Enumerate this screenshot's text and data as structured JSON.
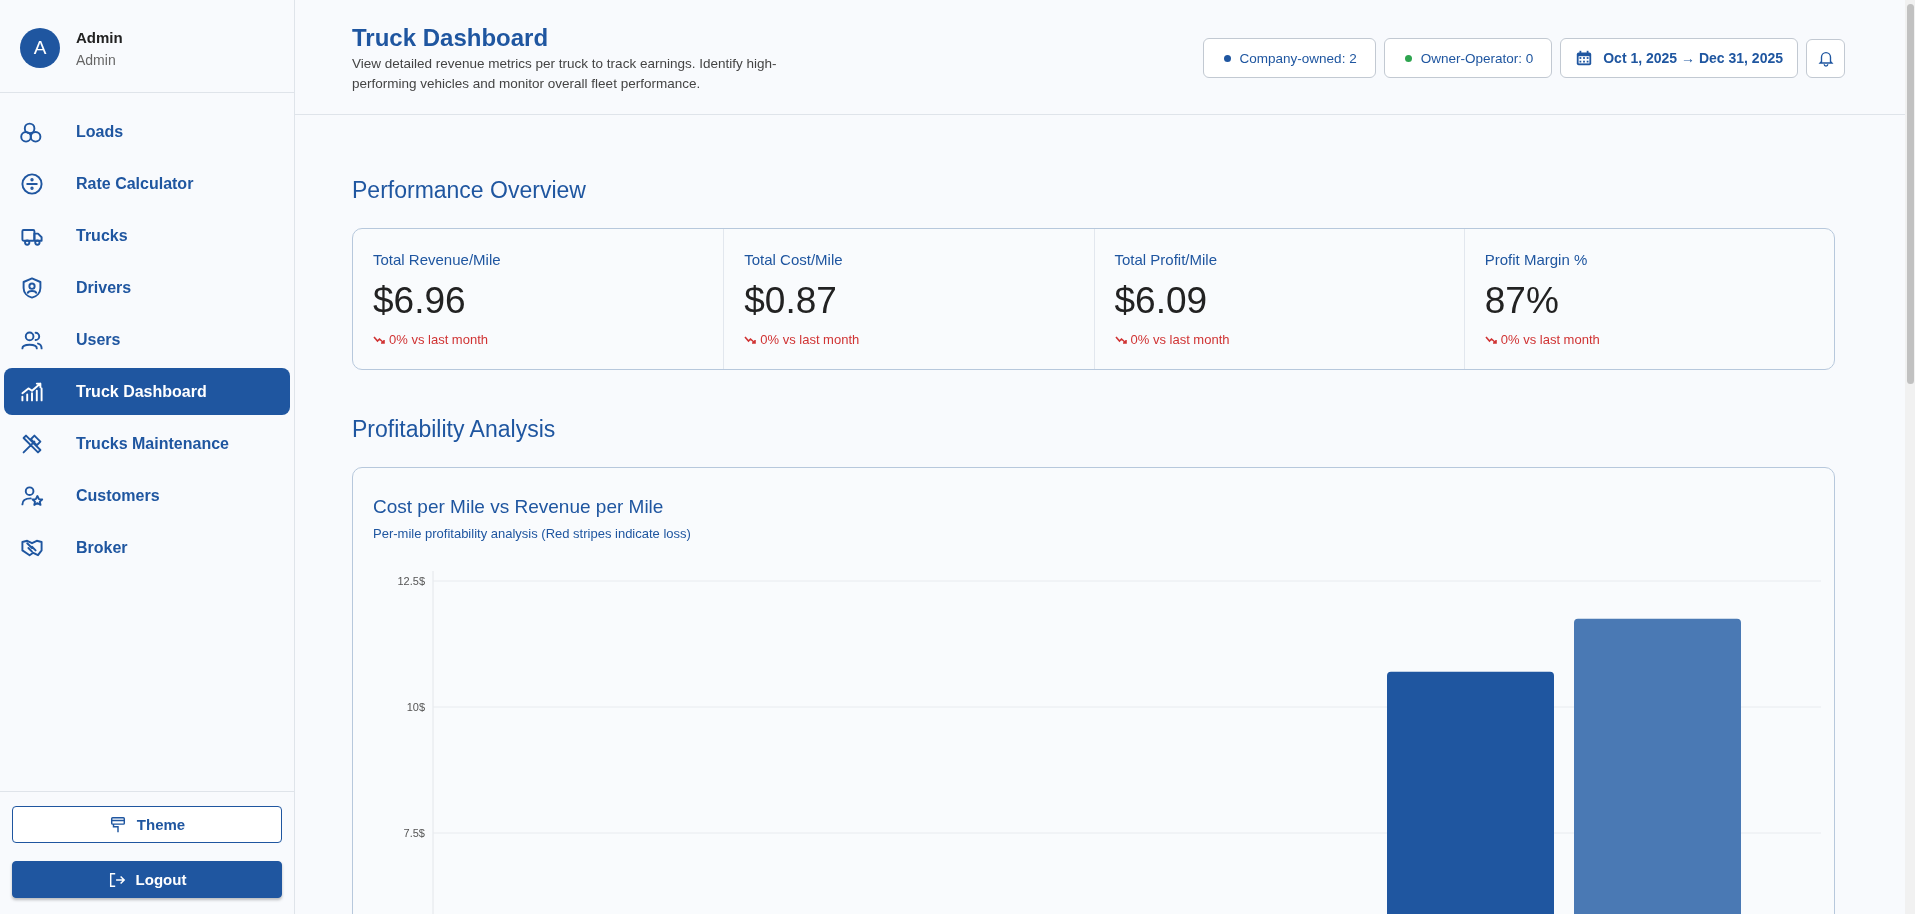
{
  "user": {
    "initial": "A",
    "name": "Admin",
    "role": "Admin"
  },
  "nav": [
    {
      "label": "Loads",
      "selected": false
    },
    {
      "label": "Rate Calculator",
      "selected": false
    },
    {
      "label": "Trucks",
      "selected": false
    },
    {
      "label": "Drivers",
      "selected": false
    },
    {
      "label": "Users",
      "selected": false
    },
    {
      "label": "Truck Dashboard",
      "selected": true
    },
    {
      "label": "Trucks Maintenance",
      "selected": false
    },
    {
      "label": "Customers",
      "selected": false
    },
    {
      "label": "Broker",
      "selected": false
    }
  ],
  "sidebar_buttons": [
    {
      "label": "Theme",
      "kind": "outline"
    },
    {
      "label": "Logout",
      "kind": "filled"
    }
  ],
  "header": {
    "title": "Truck Dashboard",
    "description": "View detailed revenue metrics per truck to track earnings. Identify high-performing vehicles and monitor overall fleet performance.",
    "badges": [
      {
        "label": "Company-owned: 2",
        "color": "#1f56a0"
      },
      {
        "label": "Owner-Operator: 0",
        "color": "#2ea44f"
      }
    ],
    "date_range": "Oct 1, 2025 → Dec 31, 2025"
  },
  "performance": {
    "title": "Performance Overview",
    "stats": [
      {
        "label": "Total Revenue/Mile",
        "value": "$6.96",
        "change": "0% vs last month"
      },
      {
        "label": "Total Cost/Mile",
        "value": "$0.87",
        "change": "0% vs last month"
      },
      {
        "label": "Total Profit/Mile",
        "value": "$6.09",
        "change": "0% vs last month"
      },
      {
        "label": "Profit Margin %",
        "value": "87%",
        "change": "0% vs last month"
      }
    ]
  },
  "profitability": {
    "title": "Profitability Analysis",
    "chart_title": "Cost per Mile vs Revenue per Mile",
    "chart_subtitle": "Per-mile profitability analysis (Red stripes indicate loss)",
    "chart_data": {
      "type": "bar",
      "ylim": [
        0,
        12.5
      ],
      "yticks": [
        {
          "value": 7.5,
          "label": "7.5$"
        },
        {
          "value": 10,
          "label": "10$"
        },
        {
          "value": 12.5,
          "label": "12.5$"
        }
      ],
      "series": [
        {
          "color": "#1f56a0",
          "values": [
            null,
            10.7
          ]
        },
        {
          "color": "#4a79b4",
          "values": [
            null,
            11.75
          ]
        }
      ]
    }
  }
}
